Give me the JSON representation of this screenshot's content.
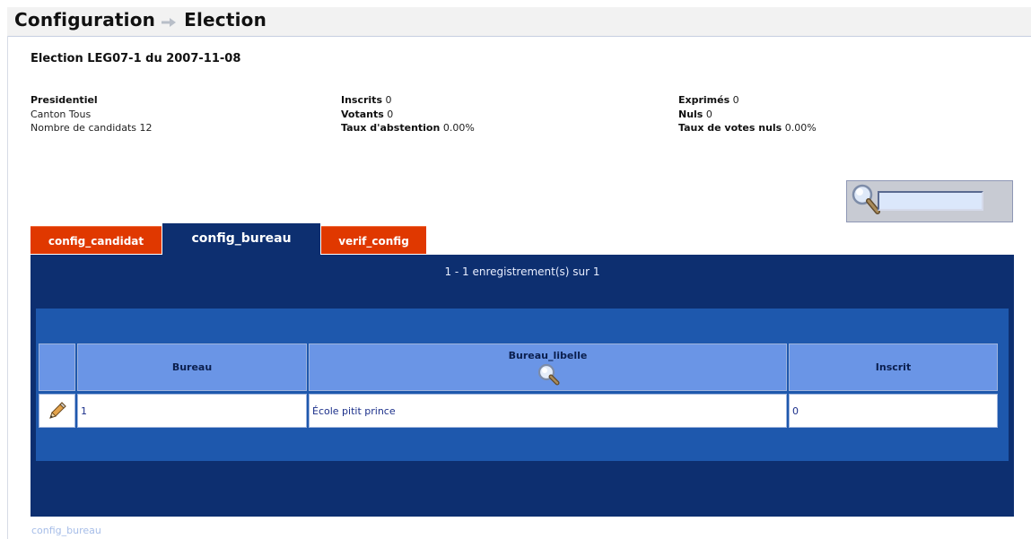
{
  "header": {
    "title_part1": "Configuration",
    "title_part2": "Election"
  },
  "election": {
    "title": "Election LEG07-1 du 2007-11-08",
    "col1": {
      "type": "Presidentiel",
      "canton_label": "Canton",
      "canton_value": "Tous",
      "candidats_label": "Nombre de candidats",
      "candidats_value": "12"
    },
    "col2": {
      "inscrits_label": "Inscrits",
      "inscrits_value": "0",
      "votants_label": "Votants",
      "votants_value": "0",
      "abstention_label": "Taux d'abstention",
      "abstention_value": "0.00%"
    },
    "col3": {
      "exprimes_label": "Exprimés",
      "exprimes_value": "0",
      "nuls_label": "Nuls",
      "nuls_value": "0",
      "votes_nuls_label": "Taux de votes nuls",
      "votes_nuls_value": "0.00%"
    }
  },
  "search": {
    "value": ""
  },
  "tabs": [
    {
      "label": "config_candidat",
      "active": false
    },
    {
      "label": "config_bureau",
      "active": true
    },
    {
      "label": "verif_config",
      "active": false
    }
  ],
  "panel": {
    "counter": "1 - 1 enregistrement(s) sur 1"
  },
  "table": {
    "columns": [
      "Bureau",
      "Bureau_libelle",
      "Inscrit"
    ],
    "rows": [
      {
        "bureau": "1",
        "libelle": "École pitit prince",
        "inscrit": "0"
      }
    ]
  },
  "footer": {
    "link": "config_bureau"
  },
  "colors": {
    "tab_inactive": "#e03800",
    "panel_dark": "#0d2f70",
    "panel_mid": "#1e58ad",
    "header_cell": "#6a95e6"
  }
}
